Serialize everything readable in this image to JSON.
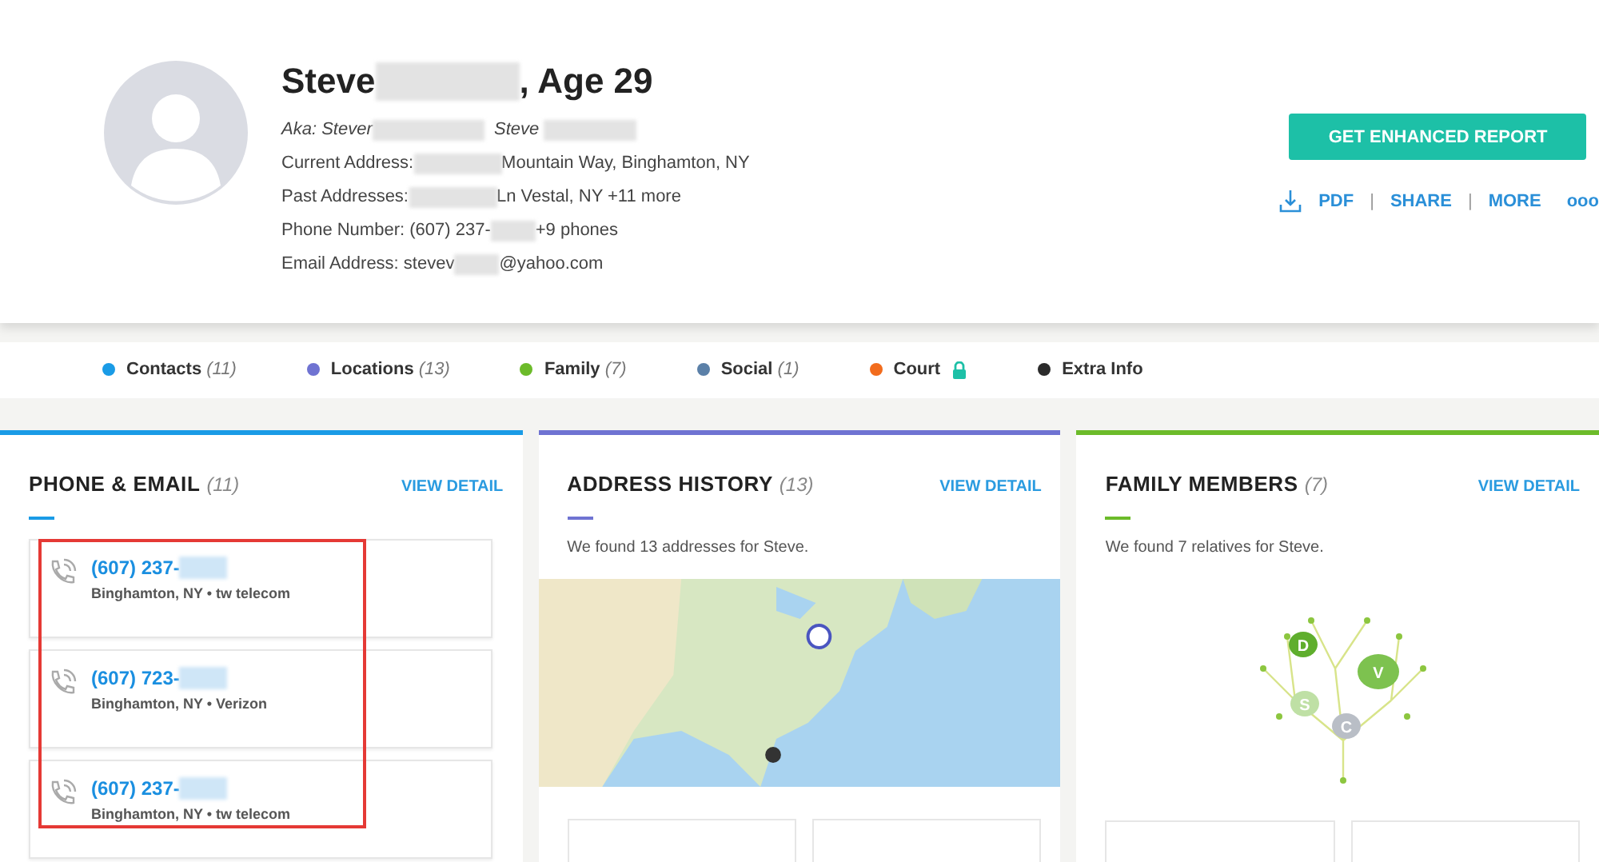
{
  "profile": {
    "name_first": "Steve",
    "name_rest": ", Age 29",
    "aka_label": "Aka:",
    "aka": [
      "Stever",
      "Steve"
    ],
    "lines": [
      {
        "label": "Current Address:",
        "after": "Mountain Way, Binghamton, NY"
      },
      {
        "label": "Past Addresses:",
        "after": "Ln Vestal, NY +11 more"
      },
      {
        "label": "Phone Number: (607) 237-",
        "after": "+9 phones"
      },
      {
        "label": "Email Address: stevev",
        "after": "@yahoo.com"
      }
    ]
  },
  "actions": {
    "primary": "GET ENHANCED REPORT",
    "links": [
      "PDF",
      "SHARE",
      "MORE"
    ],
    "separator": "|",
    "more_icon": "ooo"
  },
  "tabs": [
    {
      "label": "Contacts",
      "count": "(11)",
      "color": "#1a9be6",
      "locked": false
    },
    {
      "label": "Locations",
      "count": "(13)",
      "color": "#6f73d2",
      "locked": false
    },
    {
      "label": "Family",
      "count": "(7)",
      "color": "#6cbb2a",
      "locked": false
    },
    {
      "label": "Social",
      "count": "(1)",
      "color": "#5b80a8",
      "locked": false
    },
    {
      "label": "Court",
      "color": "#f26c1d",
      "locked": true
    },
    {
      "label": "Extra Info",
      "color": "#2b2b2b",
      "locked": false
    }
  ],
  "cards": [
    {
      "kind": "phones",
      "title": "PHONE & EMAIL",
      "count": "(11)",
      "color": "#1a9be6",
      "link": "VIEW DETAIL",
      "phones": [
        {
          "number": "(607) 237-",
          "detail": "Binghamton, NY • tw telecom"
        },
        {
          "number": "(607) 723-",
          "detail": "Binghamton, NY • Verizon"
        },
        {
          "number": "(607) 237-",
          "detail": "Binghamton, NY • tw telecom"
        }
      ]
    },
    {
      "kind": "map",
      "title": "ADDRESS HISTORY",
      "count": "(13)",
      "color": "#6f73d2",
      "link": "VIEW DETAIL",
      "text": "We found 13 addresses for Steve."
    },
    {
      "kind": "tree",
      "title": "FAMILY MEMBERS",
      "count": "(7)",
      "color": "#6cbb2a",
      "link": "VIEW DETAIL",
      "text": "We found 7 relatives for Steve.",
      "leaves": [
        "D",
        "V",
        "S",
        "C"
      ]
    }
  ]
}
